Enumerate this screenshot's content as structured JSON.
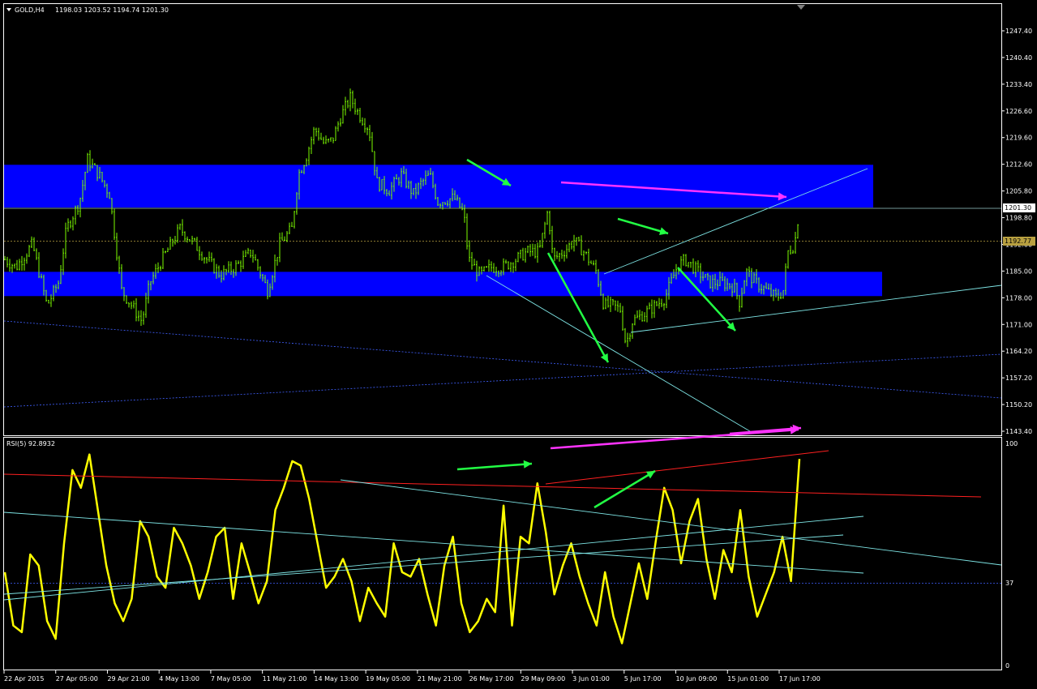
{
  "header": {
    "symbol": "GOLD,H4",
    "ohlc": "1198.03 1203.52 1194.74 1201.30"
  },
  "rsi_panel": {
    "label": "RSI(5) 92.8932",
    "scale_top": "100",
    "scale_level": "37",
    "scale_bottom": "0"
  },
  "colors": {
    "background": "#000000",
    "candle": "#7CFC00",
    "zone": "#0000ff",
    "trendline": "#7fe6e6",
    "arrow_green": "#22ff44",
    "arrow_magenta": "#ff33ff",
    "rsi_line": "#ffff00",
    "rsi_trend_red": "#ff2020",
    "current_price_bg": "#ffffff",
    "dotted_price_bg": "#b8a040"
  },
  "price_axis": {
    "labels": [
      "1247.40",
      "1240.40",
      "1233.40",
      "1226.60",
      "1219.60",
      "1212.60",
      "1205.80",
      "1198.80",
      "1192.00",
      "1185.00",
      "1178.00",
      "1171.00",
      "1164.20",
      "1157.20",
      "1150.20",
      "1143.40"
    ],
    "current_price": "1201.30",
    "dotted_price": "1192.77"
  },
  "time_axis": {
    "labels": [
      "22 Apr 2015",
      "27 Apr 05:00",
      "29 Apr 21:00",
      "4 May 13:00",
      "7 May 05:00",
      "11 May 21:00",
      "14 May 13:00",
      "19 May 05:00",
      "21 May 21:00",
      "26 May 17:00",
      "29 May 09:00",
      "3 Jun 01:00",
      "5 Jun 17:00",
      "10 Jun 09:00",
      "15 Jun 01:00",
      "17 Jun 17:00"
    ]
  },
  "chart_data": [
    {
      "type": "candlestick",
      "title": "GOLD,H4",
      "ylim": [
        1143.4,
        1247.4
      ],
      "x": [
        "22 Apr 2015",
        "27 Apr 05:00",
        "29 Apr 21:00",
        "4 May 13:00",
        "7 May 05:00",
        "11 May 21:00",
        "14 May 13:00",
        "19 May 05:00",
        "21 May 21:00",
        "26 May 17:00",
        "29 May 09:00",
        "3 Jun 01:00",
        "5 Jun 17:00",
        "10 Jun 09:00",
        "15 Jun 01:00",
        "17 Jun 17:00"
      ],
      "close": [
        1186,
        1200,
        1181,
        1189,
        1184,
        1196,
        1225,
        1210,
        1206,
        1188,
        1190,
        1177,
        1176,
        1185,
        1182,
        1201.3
      ],
      "zones": [
        [
          1201.5,
          1212.6
        ],
        [
          1178.5,
          1184.8
        ]
      ],
      "current_price": 1201.3,
      "dotted_price": 1192.77
    },
    {
      "type": "line",
      "title": "RSI(5) 92.8932",
      "ylim": [
        0,
        100
      ],
      "level": 37,
      "last_value": 92.8932,
      "values": [
        42,
        18,
        15,
        50,
        45,
        20,
        12,
        55,
        88,
        80,
        95,
        70,
        45,
        28,
        20,
        30,
        65,
        58,
        40,
        35,
        62,
        55,
        45,
        30,
        42,
        58,
        62,
        30,
        55,
        42,
        28,
        38,
        70,
        80,
        92,
        90,
        75,
        55,
        35,
        40,
        48,
        38,
        20,
        35,
        28,
        22,
        55,
        42,
        40,
        48,
        32,
        18,
        45,
        58,
        28,
        15,
        20,
        30,
        24,
        72,
        18,
        58,
        55,
        82,
        60,
        32,
        45,
        55,
        40,
        28,
        18,
        42,
        22,
        10,
        28,
        46,
        30,
        56,
        80,
        70,
        46,
        65,
        75,
        48,
        30,
        52,
        42,
        70,
        40,
        22,
        32,
        42,
        58,
        38,
        93
      ]
    }
  ]
}
